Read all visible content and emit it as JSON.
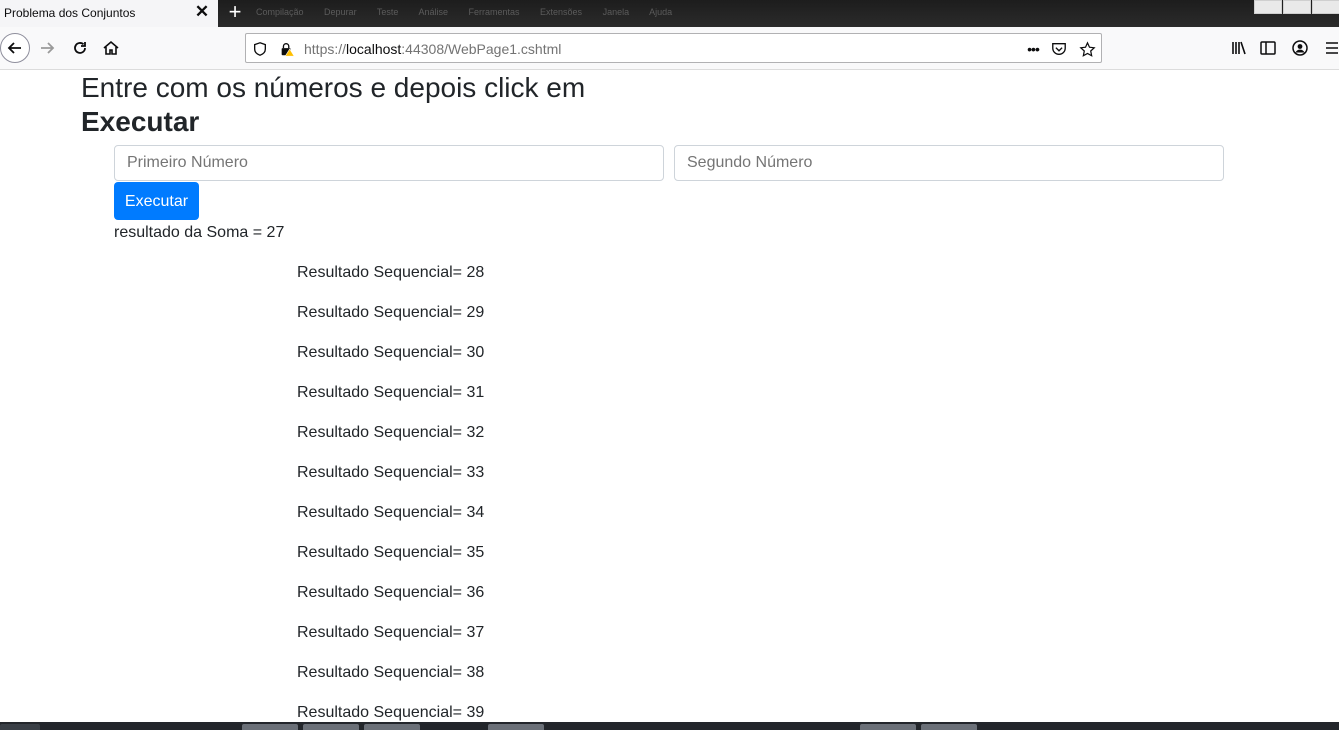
{
  "browser": {
    "tab_title": "Problema dos Conjuntos",
    "tab_close": "✕",
    "new_tab": "+",
    "background_menu": [
      "Compilação",
      "Depurar",
      "Teste",
      "Análise",
      "Ferramentas",
      "Extensões",
      "Janela",
      "Ajuda"
    ],
    "url_prefix": "https://",
    "url_host": "localhost",
    "url_rest": ":44308/WebPage1.cshtml",
    "url_more": "•••"
  },
  "page": {
    "heading_line1": "Entre com os números e depois click em",
    "heading_line2": "Executar",
    "first_placeholder": "Primeiro Número",
    "second_placeholder": "Segundo Número",
    "execute_label": "Executar",
    "sum_text": "resultado da Soma = 27",
    "sequence": [
      "Resultado Sequencial= 28",
      "Resultado Sequencial= 29",
      "Resultado Sequencial= 30",
      "Resultado Sequencial= 31",
      "Resultado Sequencial= 32",
      "Resultado Sequencial= 33",
      "Resultado Sequencial= 34",
      "Resultado Sequencial= 35",
      "Resultado Sequencial= 36",
      "Resultado Sequencial= 37",
      "Resultado Sequencial= 38",
      "Resultado Sequencial= 39"
    ]
  },
  "colors": {
    "primary_button": "#007bff",
    "text": "#212529",
    "placeholder": "#6c757d"
  }
}
